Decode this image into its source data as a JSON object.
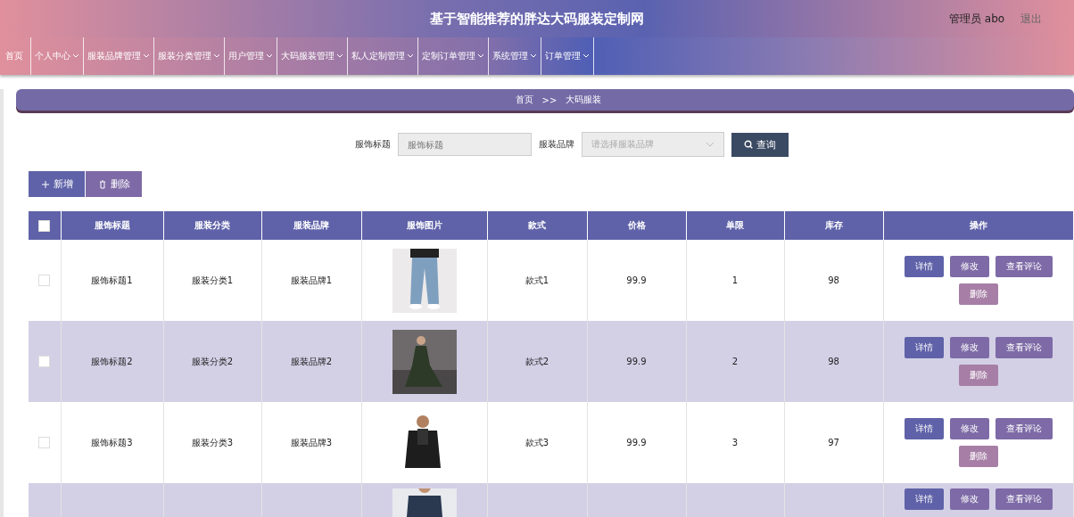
{
  "header": {
    "title": "基于智能推荐的胖达大码服装定制网",
    "user": "管理员 abo",
    "logout": "退出"
  },
  "nav": [
    {
      "label": "首页",
      "dropdown": false
    },
    {
      "label": "个人中心",
      "dropdown": true
    },
    {
      "label": "服装品牌管理",
      "dropdown": true
    },
    {
      "label": "服装分类管理",
      "dropdown": true
    },
    {
      "label": "用户管理",
      "dropdown": true
    },
    {
      "label": "大码服装管理",
      "dropdown": true
    },
    {
      "label": "私人定制管理",
      "dropdown": true
    },
    {
      "label": "定制订单管理",
      "dropdown": true
    },
    {
      "label": "系统管理",
      "dropdown": true
    },
    {
      "label": "订单管理",
      "dropdown": true
    }
  ],
  "breadcrumb": [
    "首页",
    ">>",
    "大码服装"
  ],
  "search": {
    "title_label": "服饰标题",
    "title_placeholder": "服饰标题",
    "brand_label": "服装品牌",
    "brand_placeholder": "请选择服装品牌",
    "query_button": "查询"
  },
  "actions": [
    {
      "label": "新增",
      "kind": "add"
    },
    {
      "label": "删除",
      "kind": "delete"
    }
  ],
  "table": {
    "header_checked": false,
    "columns": [
      "服饰标题",
      "服装分类",
      "服装品牌",
      "服饰图片",
      "款式",
      "价格",
      "单限",
      "库存",
      "操作"
    ],
    "rows": [
      {
        "checked": false,
        "cells": [
          "服饰标题1",
          "服装分类1",
          "服装品牌1"
        ],
        "cells2": [
          "款式1",
          "99.9",
          "1",
          "98"
        ],
        "buttons": [
          {
            "label": "详情",
            "kind": "detail"
          },
          {
            "label": "修改",
            "kind": "edit"
          },
          {
            "label": "查看评论",
            "kind": "comments"
          },
          {
            "label": "删除",
            "kind": "delete"
          }
        ]
      },
      {
        "checked": false,
        "cells": [
          "服饰标题2",
          "服装分类2",
          "服装品牌2"
        ],
        "cells2": [
          "款式2",
          "99.9",
          "2",
          "98"
        ],
        "buttons": [
          {
            "label": "详情",
            "kind": "detail"
          },
          {
            "label": "修改",
            "kind": "edit"
          },
          {
            "label": "查看评论",
            "kind": "comments"
          },
          {
            "label": "删除",
            "kind": "delete"
          }
        ]
      },
      {
        "checked": false,
        "cells": [
          "服饰标题3",
          "服装分类3",
          "服装品牌3"
        ],
        "cells2": [
          "款式3",
          "99.9",
          "3",
          "97"
        ],
        "buttons": [
          {
            "label": "详情",
            "kind": "detail"
          },
          {
            "label": "修改",
            "kind": "edit"
          },
          {
            "label": "查看评论",
            "kind": "comments"
          },
          {
            "label": "删除",
            "kind": "delete"
          }
        ]
      },
      {
        "buttons": [
          {
            "label": "详情",
            "kind": "detail"
          },
          {
            "label": "修改",
            "kind": "edit"
          },
          {
            "label": "查看评论",
            "kind": "comments"
          }
        ]
      }
    ]
  }
}
